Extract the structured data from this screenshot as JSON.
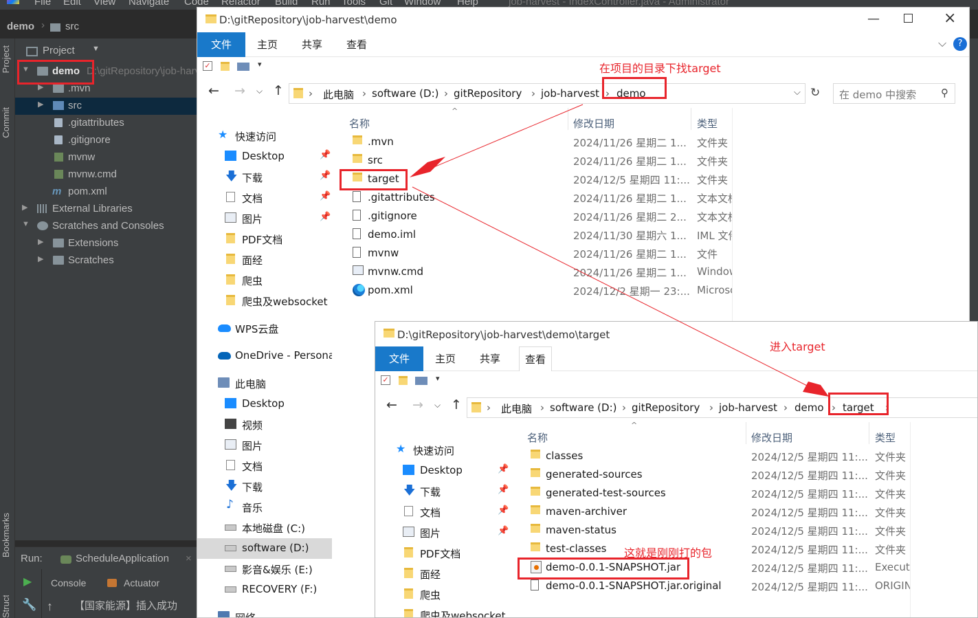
{
  "ide": {
    "menu": [
      "File",
      "Edit",
      "View",
      "Navigate",
      "Code",
      "Refactor",
      "Build",
      "Run",
      "Tools",
      "Git",
      "Window",
      "Help"
    ],
    "window_title": "job-harvest - IndexController.java - Administrator",
    "breadcrumb": {
      "project": "demo",
      "folder": "src"
    },
    "side_tabs": {
      "project": "Project",
      "commit": "Commit",
      "bookmarks": "Bookmarks",
      "structure": "Structure"
    },
    "project_panel": {
      "title": "Project",
      "root": {
        "name": "demo",
        "path": "D:\\gitRepository\\job-harvest\\demo"
      },
      "items": [
        ".mvn",
        "src",
        ".gitattributes",
        ".gitignore",
        "mvnw",
        "mvnw.cmd",
        "pom.xml"
      ],
      "external_libraries": "External Libraries",
      "scratches_and_consoles": "Scratches and Consoles",
      "scratch_children": [
        "Extensions",
        "Scratches"
      ]
    },
    "run_panel": {
      "label": "Run:",
      "config": "ScheduleApplication",
      "tabs": [
        "Console",
        "Actuator"
      ],
      "output": "【国家能源】插入成功"
    },
    "colors": {
      "background": "#2b2b2b",
      "panel": "#3c3f41",
      "selection": "#0d293e"
    }
  },
  "explorer1": {
    "title": "D:\\gitRepository\\job-harvest\\demo",
    "ribbon_tabs": [
      "文件",
      "主页",
      "共享",
      "查看"
    ],
    "address": [
      "此电脑",
      "software (D:)",
      "gitRepository",
      "job-harvest",
      "demo"
    ],
    "search_placeholder": "在 demo 中搜索",
    "columns": {
      "name": "名称",
      "date": "修改日期",
      "type": "类型"
    },
    "nav": {
      "quick_access": "快速访问",
      "quick_items": [
        "Desktop",
        "下载",
        "文档",
        "图片",
        "PDF文档",
        "面经",
        "爬虫",
        "爬虫及websocket"
      ],
      "wps": "WPS云盘",
      "onedrive": "OneDrive - Persona",
      "this_pc": "此电脑",
      "pc_items": [
        "Desktop",
        "视频",
        "图片",
        "文档",
        "下载",
        "音乐",
        "本地磁盘 (C:)",
        "software (D:)",
        "影音&娱乐 (E:)",
        "RECOVERY (F:)"
      ],
      "network": "网络"
    },
    "files": [
      {
        "name": ".mvn",
        "date": "2024/11/26 星期二 1...",
        "type": "文件夹",
        "icon": "folder"
      },
      {
        "name": "src",
        "date": "2024/11/26 星期二 1...",
        "type": "文件夹",
        "icon": "folder"
      },
      {
        "name": "target",
        "date": "2024/12/5 星期四 11:...",
        "type": "文件夹",
        "icon": "folder"
      },
      {
        "name": ".gitattributes",
        "date": "2024/11/26 星期二 1...",
        "type": "文本文档",
        "icon": "file"
      },
      {
        "name": ".gitignore",
        "date": "2024/11/26 星期二 2...",
        "type": "文本文档",
        "icon": "file"
      },
      {
        "name": "demo.iml",
        "date": "2024/11/30 星期六 1...",
        "type": "IML 文件",
        "icon": "file"
      },
      {
        "name": "mvnw",
        "date": "2024/11/26 星期二 1...",
        "type": "文件",
        "icon": "file"
      },
      {
        "name": "mvnw.cmd",
        "date": "2024/11/26 星期二 1...",
        "type": "Windows",
        "icon": "cmd"
      },
      {
        "name": "pom.xml",
        "date": "2024/12/2 星期一 23:...",
        "type": "Microsoft",
        "icon": "edge"
      }
    ]
  },
  "explorer2": {
    "title": "D:\\gitRepository\\job-harvest\\demo\\target",
    "ribbon_tabs": [
      "文件",
      "主页",
      "共享",
      "查看"
    ],
    "address": [
      "此电脑",
      "software (D:)",
      "gitRepository",
      "job-harvest",
      "demo",
      "target"
    ],
    "columns": {
      "name": "名称",
      "date": "修改日期",
      "type": "类型"
    },
    "nav": {
      "quick_access": "快速访问",
      "quick_items": [
        "Desktop",
        "下载",
        "文档",
        "图片",
        "PDF文档",
        "面经",
        "爬虫",
        "爬虫及websocket"
      ]
    },
    "files": [
      {
        "name": "classes",
        "date": "2024/12/5 星期四 11:...",
        "type": "文件夹",
        "icon": "folder"
      },
      {
        "name": "generated-sources",
        "date": "2024/12/5 星期四 11:...",
        "type": "文件夹",
        "icon": "folder"
      },
      {
        "name": "generated-test-sources",
        "date": "2024/12/5 星期四 11:...",
        "type": "文件夹",
        "icon": "folder"
      },
      {
        "name": "maven-archiver",
        "date": "2024/12/5 星期四 11:...",
        "type": "文件夹",
        "icon": "folder"
      },
      {
        "name": "maven-status",
        "date": "2024/12/5 星期四 11:...",
        "type": "文件夹",
        "icon": "folder"
      },
      {
        "name": "test-classes",
        "date": "2024/12/5 星期四 11:...",
        "type": "文件夹",
        "icon": "folder"
      },
      {
        "name": "demo-0.0.1-SNAPSHOT.jar",
        "date": "2024/12/5 星期四 11:...",
        "type": "Executable",
        "icon": "jar"
      },
      {
        "name": "demo-0.0.1-SNAPSHOT.jar.original",
        "date": "2024/12/5 星期四 11:...",
        "type": "ORIGINAL",
        "icon": "file"
      }
    ]
  },
  "annotations": {
    "find_target": "在项目的目录下找target",
    "enter_target": "进入target",
    "package_note": "这就是刚刚打的包",
    "color": "#e8242b"
  }
}
